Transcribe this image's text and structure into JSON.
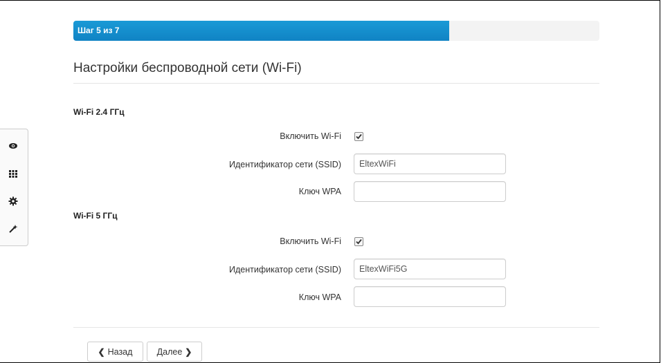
{
  "progress": {
    "label": "Шаг 5 из 7",
    "fraction": 0.714
  },
  "page_title": "Настройки беспроводной сети (Wi-Fi)",
  "sidebar": {
    "items": [
      {
        "icon": "eye-icon"
      },
      {
        "icon": "grid-icon"
      },
      {
        "icon": "gear-icon"
      },
      {
        "icon": "magic-wand-icon"
      }
    ]
  },
  "wifi24": {
    "title": "Wi-Fi 2.4 ГГц",
    "enable_label": "Включить Wi-Fi",
    "enabled": true,
    "ssid_label": "Идентификатор сети (SSID)",
    "ssid_value": "EltexWiFi",
    "wpa_label": "Ключ WPA",
    "wpa_value": ""
  },
  "wifi5": {
    "title": "Wi-Fi 5 ГГц",
    "enable_label": "Включить Wi-Fi",
    "enabled": true,
    "ssid_label": "Идентификатор сети (SSID)",
    "ssid_value": "EltexWiFi5G",
    "wpa_label": "Ключ WPA",
    "wpa_value": ""
  },
  "buttons": {
    "back": "Назад",
    "next": "Далее",
    "back_chevron": "❮",
    "next_chevron": "❯"
  },
  "colors": {
    "progress": "#1a8fd0",
    "progress_track": "#f3f3f3"
  }
}
